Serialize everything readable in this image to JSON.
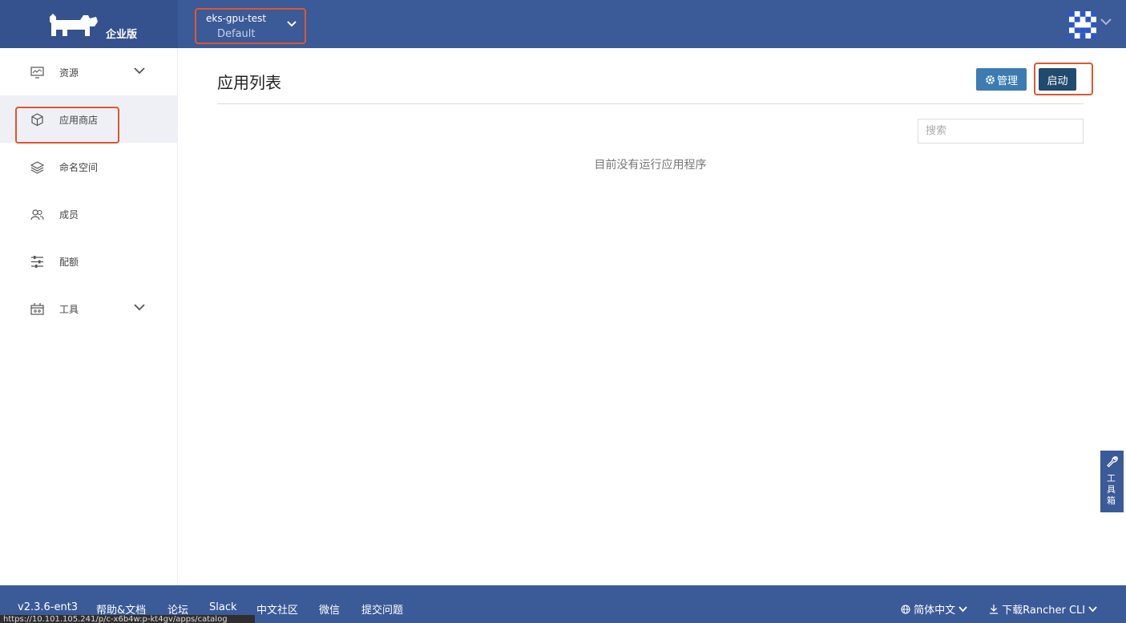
{
  "header": {
    "edition": "企业版",
    "cluster_name": "eks-gpu-test",
    "project_name": "Default"
  },
  "sidebar": {
    "items": [
      {
        "label": "资源",
        "icon": "monitor-icon",
        "expandable": true
      },
      {
        "label": "应用商店",
        "icon": "cube-icon",
        "active": true
      },
      {
        "label": "命名空间",
        "icon": "layers-icon"
      },
      {
        "label": "成员",
        "icon": "users-icon"
      },
      {
        "label": "配额",
        "icon": "sliders-icon"
      },
      {
        "label": "工具",
        "icon": "toolbox-icon",
        "expandable": true
      }
    ]
  },
  "main": {
    "title": "应用列表",
    "manage_label": "管理",
    "launch_label": "启动",
    "search_placeholder": "搜索",
    "empty_message": "目前没有运行应用程序"
  },
  "toolbox": {
    "label": "工具箱"
  },
  "footer": {
    "version": "v2.3.6-ent3",
    "links": [
      "帮助&文档",
      "论坛",
      "Slack",
      "中文社区",
      "微信",
      "提交问题"
    ],
    "language": "简体中文",
    "download": "下载Rancher CLI",
    "status_url": "https://10.101.105.241/p/c-x6b4w:p-kt4gv/apps/catalog"
  },
  "colors": {
    "header_bg": "#3b5a98",
    "highlight": "#e0562e",
    "manage_button": "#3d7bb3",
    "launch_button": "#214b6e"
  }
}
